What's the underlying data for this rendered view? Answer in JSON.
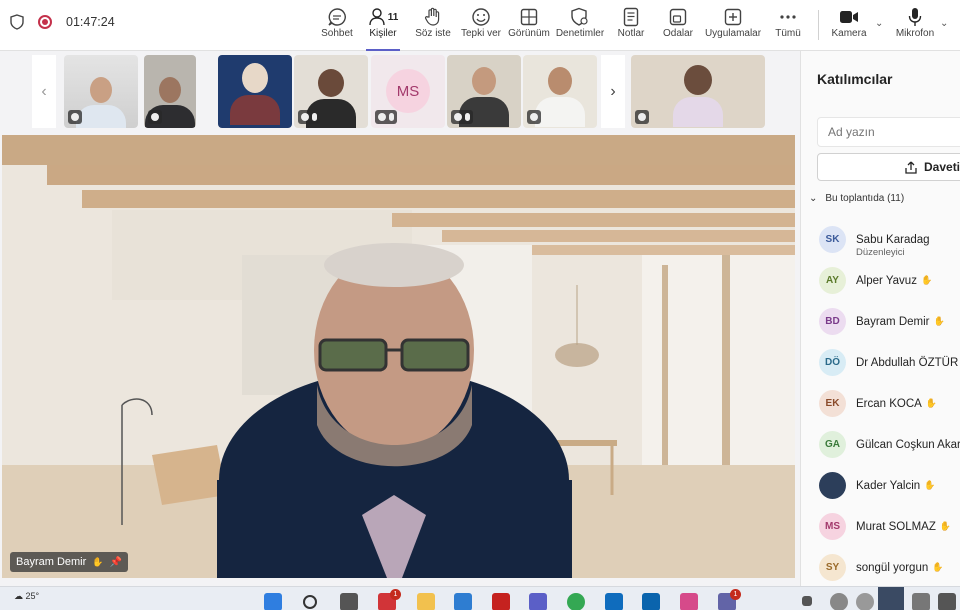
{
  "meeting": {
    "timer": "01:47:24"
  },
  "toolbar": {
    "chat": "Sohbet",
    "people": "Kişiler",
    "people_count": "11",
    "raise": "Söz iste",
    "react": "Tepki ver",
    "view": "Görünüm",
    "controls": "Denetimler",
    "notes": "Notlar",
    "rooms": "Odalar",
    "apps": "Uygulamalar",
    "more": "Tümü",
    "camera": "Kamera",
    "mic": "Mikrofon"
  },
  "thumbnails": {
    "ms_initials": "MS"
  },
  "main_video": {
    "name": "Bayram Demir"
  },
  "panel": {
    "title": "Katılımcılar",
    "search_placeholder": "Ad yazın",
    "invite_label": "Daveti",
    "in_meeting": "Bu toplantıda (11)",
    "participants": [
      {
        "initials": "SK",
        "name": "Sabu Karadag",
        "role": "Düzenleyici",
        "bg": "#dce4f5",
        "fg": "#3b5a9a"
      },
      {
        "initials": "AY",
        "name": "Alper Yavuz",
        "bg": "#e7f0d8",
        "fg": "#5b7a2a"
      },
      {
        "initials": "BD",
        "name": "Bayram Demir",
        "bg": "#ecdcf0",
        "fg": "#7a3a8a"
      },
      {
        "initials": "DÖ",
        "name": "Dr Abdullah ÖZTÜR",
        "bg": "#d8ecf5",
        "fg": "#2a6a8a"
      },
      {
        "initials": "EK",
        "name": "Ercan KOCA",
        "bg": "#f3e0d6",
        "fg": "#8a4a2a"
      },
      {
        "initials": "GA",
        "name": "Gülcan Coşkun Akar",
        "bg": "#e0f0dc",
        "fg": "#3a7a3a"
      },
      {
        "initials": "",
        "name": "Kader Yalcin",
        "bg": "#2c3e5a",
        "fg": "#ffffff"
      },
      {
        "initials": "MS",
        "name": "Murat SOLMAZ",
        "bg": "#f6d3e0",
        "fg": "#a33a6c"
      },
      {
        "initials": "SY",
        "name": "songül yorgun",
        "bg": "#f5e6d0",
        "fg": "#9a6a2a"
      }
    ]
  },
  "taskbar": {
    "temperature": "25°",
    "badge_1": "1",
    "badge_2": "1"
  }
}
